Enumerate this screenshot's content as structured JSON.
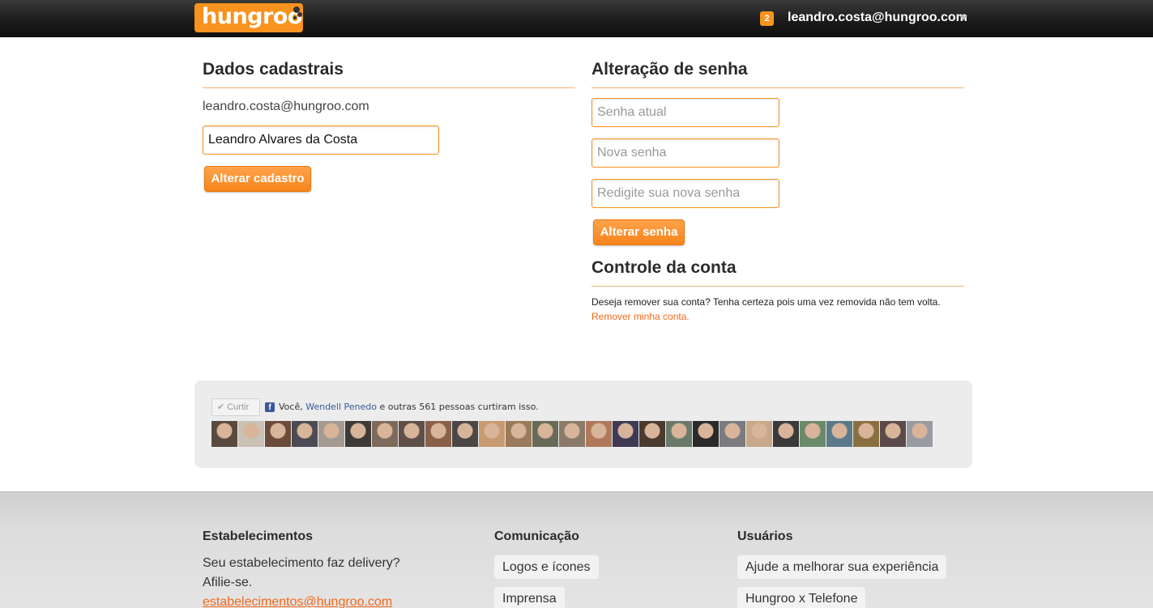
{
  "header": {
    "logo_text": "hungroo",
    "notification_count": "2",
    "user_email": "leandro.costa@hungroo.com"
  },
  "profile": {
    "title": "Dados cadastrais",
    "email": "leandro.costa@hungroo.com",
    "name_value": "Leandro Alvares da Costa",
    "submit_label": "Alterar cadastro"
  },
  "password": {
    "title": "Alteração de senha",
    "current_placeholder": "Senha atual",
    "new_placeholder": "Nova senha",
    "confirm_placeholder": "Redigite sua nova senha",
    "submit_label": "Alterar senha"
  },
  "account": {
    "title": "Controle da conta",
    "warning": "Deseja remover sua conta? Tenha certeza pois uma vez removida não tem volta.",
    "remove_link": "Remover minha conta."
  },
  "facebook": {
    "like_label": "Curtir",
    "text_prefix": "Você, ",
    "friend_name": "Wendell Penedo",
    "text_suffix": " e outras 561 pessoas curtiram isso.",
    "face_colors": [
      "#5a4a3e",
      "#c9c1b5",
      "#6b4b3a",
      "#4c4a52",
      "#a39a92",
      "#3d3a38",
      "#7e6a5a",
      "#5e5048",
      "#8a6048",
      "#4a4746",
      "#c79a72",
      "#9a7a5a",
      "#6a6a58",
      "#8a7a6a",
      "#b07a5a",
      "#3e3a55",
      "#4a3a30",
      "#6a7a6a",
      "#2a2a2a",
      "#7a7a80",
      "#c8a888",
      "#3a3a3a",
      "#6a8a6a",
      "#5a7a8a",
      "#8a7040",
      "#5a4a4a",
      "#9a9aa2"
    ]
  },
  "footer": {
    "col1": {
      "title": "Estabelecimentos",
      "line1": "Seu estabelecimento faz delivery?",
      "line2": "Afilie-se.",
      "email": "estabelecimentos@hungroo.com"
    },
    "col2": {
      "title": "Comunicação",
      "link1": "Logos e ícones",
      "link2": "Imprensa"
    },
    "col3": {
      "title": "Usuários",
      "link1": "Ajude a melhorar sua experiência",
      "link2": "Hungroo x Telefone"
    }
  }
}
